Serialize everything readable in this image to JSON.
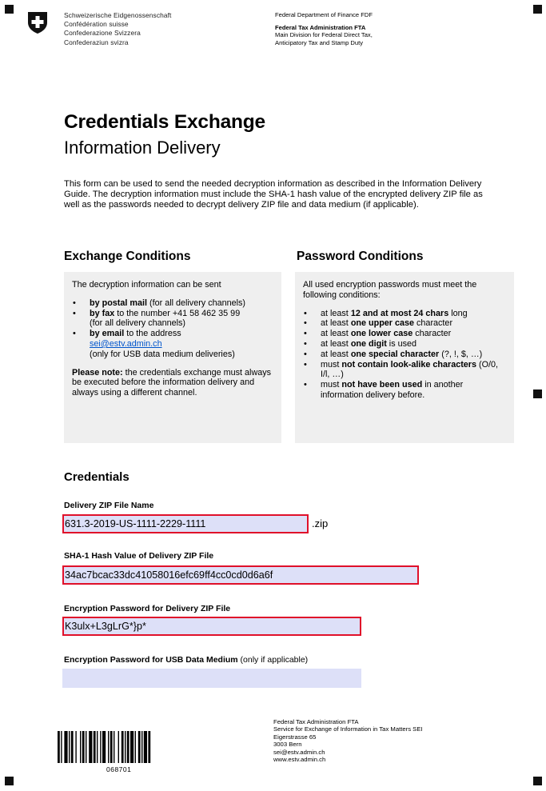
{
  "header": {
    "confederation": [
      "Schweizerische Eidgenossenschaft",
      "Confédération suisse",
      "Confederazione Svizzera",
      "Confederaziun svizra"
    ],
    "department": "Federal Department of Finance FDF",
    "administration": "Federal Tax Administration FTA",
    "division_lines": [
      "Main Division for Federal Direct Tax,",
      "Anticipatory Tax and Stamp Duty"
    ]
  },
  "title": "Credentials Exchange",
  "subtitle": "Information Delivery",
  "intro": "This form can be used to send the needed decryption information as described in the Information Delivery Guide. The decryption information must include the SHA-1 hash value of the encrypted delivery ZIP file as well as the passwords needed to decrypt delivery ZIP file and data medium (if applicable).",
  "exchange": {
    "heading": "Exchange Conditions",
    "lead": "The decryption information can be sent",
    "items": [
      {
        "bold": "by postal mail",
        "text": " (for all delivery channels)"
      },
      {
        "bold": "by fax",
        "text": " to the number +41 58 462 35 99",
        "line2": "(for all delivery channels)"
      },
      {
        "bold": "by email",
        "text": " to the address",
        "link": "sei@estv.admin.ch",
        "line3": "(only for USB data medium deliveries)"
      }
    ],
    "note_bold": "Please note:",
    "note_text": " the credentials exchange must always be executed before the information delivery and always using a different channel."
  },
  "password": {
    "heading": "Password Conditions",
    "lead": "All used encryption passwords must meet the following conditions:",
    "items": [
      {
        "pre": "at least ",
        "bold": "12 and at most 24 chars",
        "post": " long"
      },
      {
        "pre": "at least ",
        "bold": "one upper case",
        "post": " character"
      },
      {
        "pre": "at least ",
        "bold": "one lower case",
        "post": " character"
      },
      {
        "pre": "at least ",
        "bold": "one digit",
        "post": " is used"
      },
      {
        "pre": "at least ",
        "bold": "one special character",
        "post": " (?, !, $, …)"
      },
      {
        "pre": "must ",
        "bold": "not contain look-alike characters",
        "post": " (O/0, I/l, …)"
      },
      {
        "pre": "must ",
        "bold": "not have been used",
        "post": " in another information delivery before."
      }
    ]
  },
  "credentials": {
    "heading": "Credentials",
    "zip_label": "Delivery ZIP File Name",
    "zip_value": "631.3-2019-US-1111-2229-1111",
    "zip_suffix": ".zip",
    "sha_label": "SHA-1 Hash Value of Delivery ZIP File",
    "sha_value": "34ac7bcac33dc41058016efc69ff4cc0cd0d6a6f",
    "zip_pw_label": "Encryption Password for Delivery ZIP File",
    "zip_pw_value": "K3ulx+L3gLrG*}p*",
    "usb_pw_label": "Encryption Password for USB Data Medium",
    "usb_pw_note": " (only if applicable)",
    "usb_pw_value": ""
  },
  "barcode_number": "068701",
  "footer_address": [
    "Federal Tax Administration FTA",
    "Service for Exchange of Information in Tax Matters SEI",
    "Eigerstrasse 65",
    "3003 Bern",
    "sei@estv.admin.ch",
    "www.estv.admin.ch"
  ],
  "colors": {
    "field_fill": "#dde0f8",
    "highlight_border": "#e0102a",
    "box_fill": "#efefef",
    "link": "#0055cc"
  }
}
